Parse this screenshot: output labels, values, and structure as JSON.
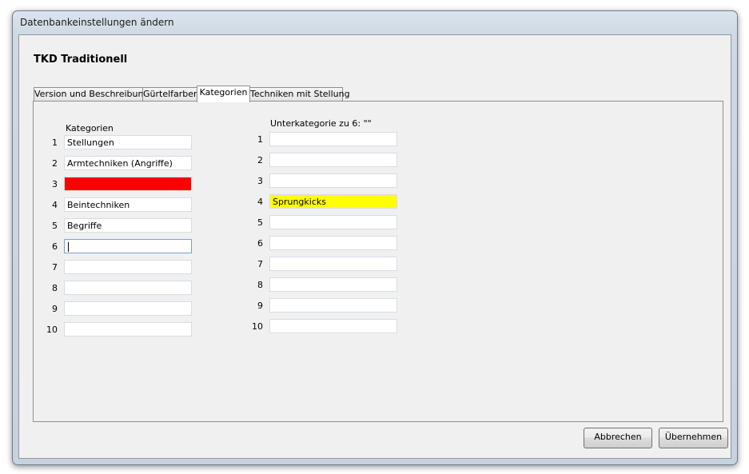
{
  "window": {
    "title": "Datenbankeinstellungen ändern"
  },
  "app_title": "TKD Traditionell",
  "tabs": [
    {
      "label": "Version und Beschreibung",
      "active": false
    },
    {
      "label": "Gürtelfarben",
      "active": false
    },
    {
      "label": "Kategorien",
      "active": true
    },
    {
      "label": "Techniken mit Stellung",
      "active": false
    }
  ],
  "categories": {
    "header": "Kategorien",
    "rows": [
      {
        "num": "1",
        "value": "Stellungen"
      },
      {
        "num": "2",
        "value": "Armtechniken (Angriffe)"
      },
      {
        "num": "3",
        "value": "",
        "bg": "#ff0000"
      },
      {
        "num": "4",
        "value": "Beintechniken"
      },
      {
        "num": "5",
        "value": "Begriffe"
      },
      {
        "num": "6",
        "value": "",
        "focused": true
      },
      {
        "num": "7",
        "value": ""
      },
      {
        "num": "8",
        "value": ""
      },
      {
        "num": "9",
        "value": ""
      },
      {
        "num": "10",
        "value": ""
      }
    ]
  },
  "subcategories": {
    "header": "Unterkategorie zu 6: \"\"",
    "rows": [
      {
        "num": "1",
        "value": ""
      },
      {
        "num": "2",
        "value": ""
      },
      {
        "num": "3",
        "value": ""
      },
      {
        "num": "4",
        "value": "Sprungkicks",
        "bg": "#ffff00"
      },
      {
        "num": "5",
        "value": ""
      },
      {
        "num": "6",
        "value": ""
      },
      {
        "num": "7",
        "value": ""
      },
      {
        "num": "8",
        "value": ""
      },
      {
        "num": "9",
        "value": ""
      },
      {
        "num": "10",
        "value": ""
      }
    ]
  },
  "buttons": {
    "cancel": "Abbrechen",
    "apply": "Übernehmen"
  }
}
